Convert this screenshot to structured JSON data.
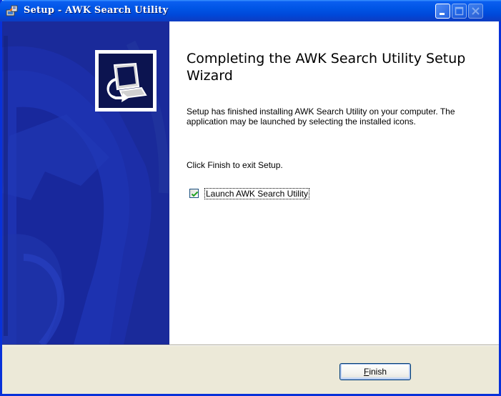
{
  "window": {
    "title": "Setup - AWK Search Utility"
  },
  "icons": {
    "title_icon": "setup-installer-icon",
    "logo": "computer-with-arrow-logo",
    "check": "checkmark-icon"
  },
  "colors": {
    "titlebar": "#0055e5",
    "sidepanel": "#1a2a9a",
    "window_bg": "#ece9d8",
    "content_bg": "#ffffff"
  },
  "content": {
    "heading": "Completing the AWK Search Utility Setup Wizard",
    "paragraph1": "Setup has finished installing AWK Search Utility on your computer. The application may be launched by selecting the installed icons.",
    "paragraph2": "Click Finish to exit Setup.",
    "launch_checkbox": {
      "label": "Launch AWK Search Utility",
      "checked": true
    }
  },
  "buttons": {
    "finish_mnemonic": "F",
    "finish_rest": "inish"
  }
}
